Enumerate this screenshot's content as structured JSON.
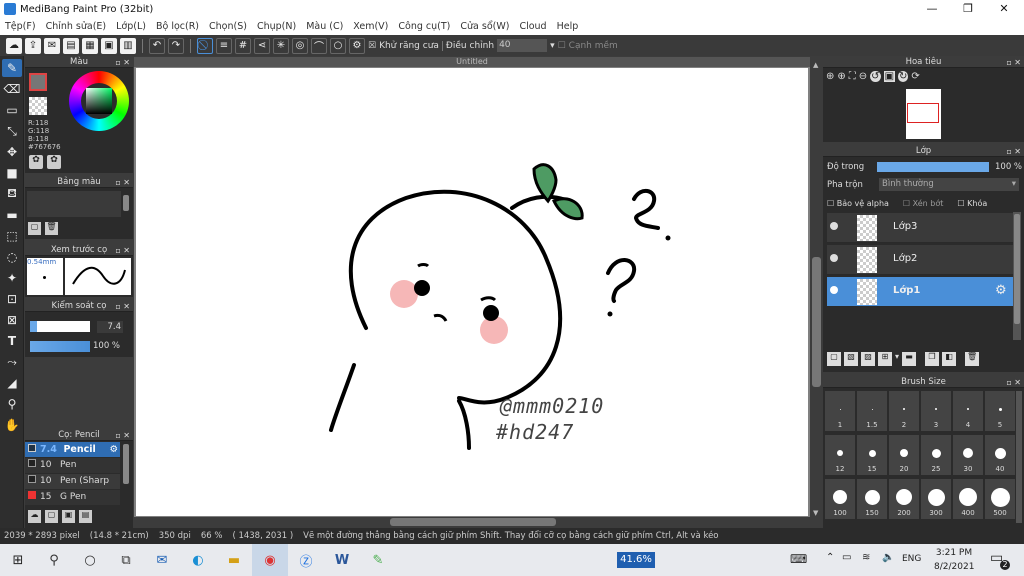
{
  "app": {
    "title": "MediBang Paint Pro (32bit)"
  },
  "menu": [
    "Tệp(F)",
    "Chỉnh sửa(E)",
    "Lớp(L)",
    "Bộ lọc(R)",
    "Chọn(S)",
    "Chụp(N)",
    "Màu (C)",
    "Xem(V)",
    "Công cụ(T)",
    "Cửa sổ(W)",
    "Cloud",
    "Help"
  ],
  "toolbar": {
    "antialias_label": "Khử răng cưa",
    "adjust_label": "Điều chỉnh",
    "adjust_value": "40",
    "edge_label": "Cạnh mềm"
  },
  "color_panel": {
    "title": "Màu",
    "r": "R:118",
    "g": "G:118",
    "b": "B:118",
    "hex": "#767676"
  },
  "palette_panel": {
    "title": "Bảng màu"
  },
  "preview_panel": {
    "title": "Xem trước cọ",
    "size": "0.54mm"
  },
  "control_panel": {
    "title": "Kiểm soát cọ",
    "size_value": "7.4",
    "opacity_value": "100 %"
  },
  "brush_panel": {
    "title": "Cọ: Pencil",
    "items": [
      {
        "size": "7.4",
        "name": "Pencil"
      },
      {
        "size": "10",
        "name": "Pen"
      },
      {
        "size": "10",
        "name": "Pen (Sharp"
      },
      {
        "size": "15",
        "name": "G Pen"
      }
    ]
  },
  "canvas": {
    "title": "Untitled",
    "signature_line1": "@mmm0210",
    "signature_line2": "#hd247"
  },
  "navigator": {
    "title": "Hoa tiêu"
  },
  "layer_panel": {
    "title": "Lớp",
    "opacity_label": "Độ trong",
    "opacity_value": "100 %",
    "blend_label": "Pha trộn",
    "blend_value": "Bình thường",
    "protect_alpha": "Bảo vệ alpha",
    "clipping": "Xén bớt",
    "lock": "Khóa",
    "layers": [
      "Lớp3",
      "Lớp2",
      "Lớp1"
    ],
    "opacity_fraction": 1.0
  },
  "brush_size_panel": {
    "title": "Brush Size",
    "sizes": [
      "1",
      "1.5",
      "2",
      "3",
      "4",
      "5",
      "12",
      "15",
      "20",
      "25",
      "30",
      "40",
      "100",
      "150",
      "200",
      "300",
      "400",
      "500"
    ]
  },
  "status": {
    "dims": "2039 * 2893 pixel",
    "mm": "(14.8 * 21cm)",
    "dpi": "350 dpi",
    "zoom": "66 %",
    "coords": "( 1438, 2031 )",
    "hint": "Vẽ một đường thẳng bằng cách giữ phím Shift. Thay đổi cỡ cọ bằng cách giữ phím Ctrl, Alt và kéo"
  },
  "taskbar": {
    "zoom_box": "41.6%",
    "lang": "ENG",
    "time": "3:21 PM",
    "date": "8/2/2021",
    "notif": "2"
  },
  "colors": {
    "accent": "#4a8fd8",
    "panel": "#2b2b2b",
    "brush_selected": "#2f6db3"
  }
}
